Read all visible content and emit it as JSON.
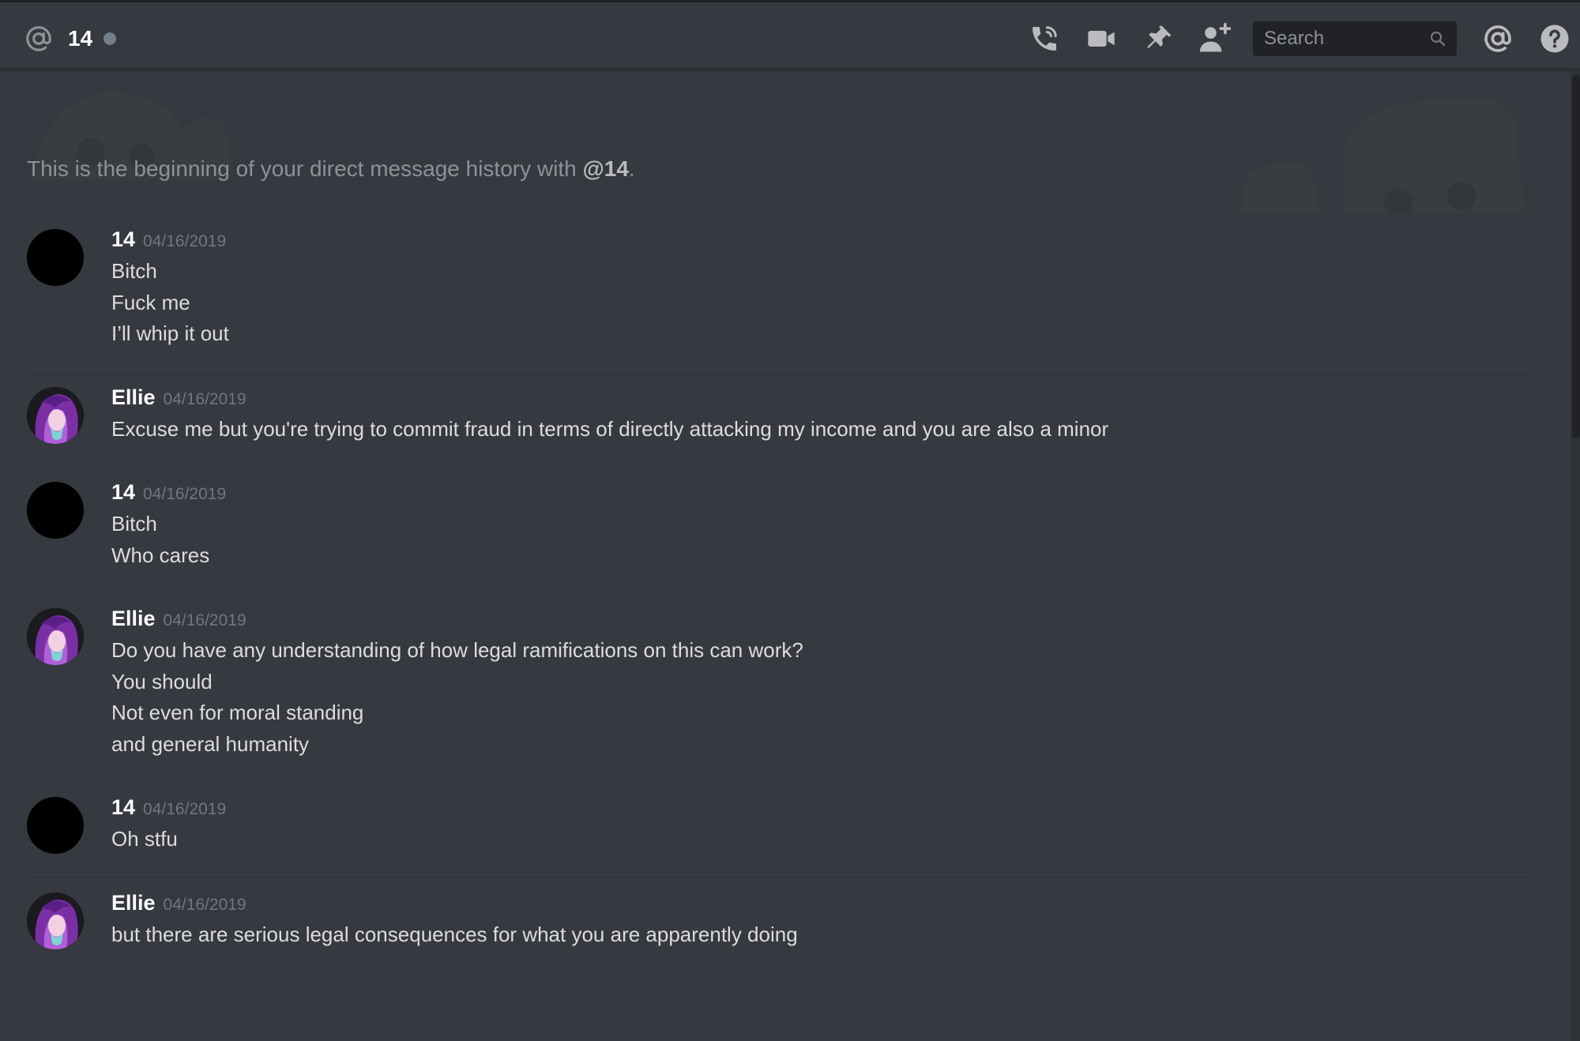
{
  "header": {
    "channel_name": "14",
    "search_placeholder": "Search",
    "icons": [
      "at-icon",
      "call-icon",
      "video-icon",
      "pin-icon",
      "add-friend-icon",
      "search-icon",
      "mentions-icon",
      "help-icon"
    ]
  },
  "welcome": {
    "prefix": "This is the beginning of your direct message history with ",
    "handle": "@14",
    "suffix": "."
  },
  "messages": [
    {
      "author": "14",
      "timestamp": "04/16/2019",
      "avatar": "black-avatar",
      "lines": [
        "Bitch",
        "Fuck me",
        "I’ll whip it out"
      ]
    },
    {
      "author": "Ellie",
      "timestamp": "04/16/2019",
      "avatar": "ellie-avatar",
      "lines": [
        "Excuse me but you're trying to commit fraud in terms of directly attacking my income and you are also a minor"
      ]
    },
    {
      "author": "14",
      "timestamp": "04/16/2019",
      "avatar": "black-avatar",
      "lines": [
        "Bitch",
        "Who cares"
      ]
    },
    {
      "author": "Ellie",
      "timestamp": "04/16/2019",
      "avatar": "ellie-avatar",
      "lines": [
        "Do you have any understanding of how legal ramifications on this can work?",
        "You should",
        "Not even for moral standing",
        "and general humanity"
      ]
    },
    {
      "author": "14",
      "timestamp": "04/16/2019",
      "avatar": "black-avatar",
      "lines": [
        "Oh stfu"
      ]
    },
    {
      "author": "Ellie",
      "timestamp": "04/16/2019",
      "avatar": "ellie-avatar",
      "lines": [
        "but there are serious legal consequences for what you are apparently doing"
      ]
    }
  ],
  "colors": {
    "background": "#36393f",
    "search_bg": "#202225",
    "author": "#ffffff",
    "timestamp": "#72767d",
    "message_text": "#dcddde",
    "icon": "#b9bbbe"
  }
}
